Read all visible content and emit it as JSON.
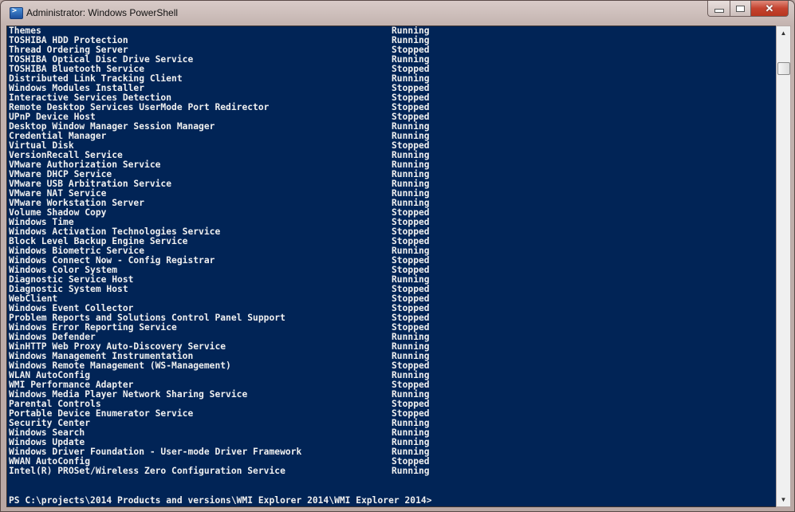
{
  "window": {
    "title": "Administrator: Windows PowerShell",
    "icon": "powershell-icon",
    "controls": {
      "minimize": "minimize-icon",
      "maximize": "maximize-icon",
      "close": "close-icon"
    }
  },
  "console": {
    "background": "#012456",
    "foreground": "#f0f0f0",
    "services": [
      {
        "name": "Themes",
        "status": "Running"
      },
      {
        "name": "TOSHIBA HDD Protection",
        "status": "Running"
      },
      {
        "name": "Thread Ordering Server",
        "status": "Stopped"
      },
      {
        "name": "TOSHIBA Optical Disc Drive Service",
        "status": "Running"
      },
      {
        "name": "TOSHIBA Bluetooth Service",
        "status": "Stopped"
      },
      {
        "name": "Distributed Link Tracking Client",
        "status": "Running"
      },
      {
        "name": "Windows Modules Installer",
        "status": "Stopped"
      },
      {
        "name": "Interactive Services Detection",
        "status": "Stopped"
      },
      {
        "name": "Remote Desktop Services UserMode Port Redirector",
        "status": "Stopped"
      },
      {
        "name": "UPnP Device Host",
        "status": "Stopped"
      },
      {
        "name": "Desktop Window Manager Session Manager",
        "status": "Running"
      },
      {
        "name": "Credential Manager",
        "status": "Running"
      },
      {
        "name": "Virtual Disk",
        "status": "Stopped"
      },
      {
        "name": "VersionRecall Service",
        "status": "Running"
      },
      {
        "name": "VMware Authorization Service",
        "status": "Running"
      },
      {
        "name": "VMware DHCP Service",
        "status": "Running"
      },
      {
        "name": "VMware USB Arbitration Service",
        "status": "Running"
      },
      {
        "name": "VMware NAT Service",
        "status": "Running"
      },
      {
        "name": "VMware Workstation Server",
        "status": "Running"
      },
      {
        "name": "Volume Shadow Copy",
        "status": "Stopped"
      },
      {
        "name": "Windows Time",
        "status": "Stopped"
      },
      {
        "name": "Windows Activation Technologies Service",
        "status": "Stopped"
      },
      {
        "name": "Block Level Backup Engine Service",
        "status": "Stopped"
      },
      {
        "name": "Windows Biometric Service",
        "status": "Running"
      },
      {
        "name": "Windows Connect Now - Config Registrar",
        "status": "Stopped"
      },
      {
        "name": "Windows Color System",
        "status": "Stopped"
      },
      {
        "name": "Diagnostic Service Host",
        "status": "Running"
      },
      {
        "name": "Diagnostic System Host",
        "status": "Stopped"
      },
      {
        "name": "WebClient",
        "status": "Stopped"
      },
      {
        "name": "Windows Event Collector",
        "status": "Stopped"
      },
      {
        "name": "Problem Reports and Solutions Control Panel Support",
        "status": "Stopped"
      },
      {
        "name": "Windows Error Reporting Service",
        "status": "Stopped"
      },
      {
        "name": "Windows Defender",
        "status": "Running"
      },
      {
        "name": "WinHTTP Web Proxy Auto-Discovery Service",
        "status": "Running"
      },
      {
        "name": "Windows Management Instrumentation",
        "status": "Running"
      },
      {
        "name": "Windows Remote Management (WS-Management)",
        "status": "Stopped"
      },
      {
        "name": "WLAN AutoConfig",
        "status": "Running"
      },
      {
        "name": "WMI Performance Adapter",
        "status": "Stopped"
      },
      {
        "name": "Windows Media Player Network Sharing Service",
        "status": "Running"
      },
      {
        "name": "Parental Controls",
        "status": "Stopped"
      },
      {
        "name": "Portable Device Enumerator Service",
        "status": "Stopped"
      },
      {
        "name": "Security Center",
        "status": "Running"
      },
      {
        "name": "Windows Search",
        "status": "Running"
      },
      {
        "name": "Windows Update",
        "status": "Running"
      },
      {
        "name": "Windows Driver Foundation - User-mode Driver Framework",
        "status": "Running"
      },
      {
        "name": "WWAN AutoConfig",
        "status": "Stopped"
      },
      {
        "name": "Intel(R) PROSet/Wireless Zero Configuration Service",
        "status": "Running"
      }
    ],
    "prompt": "PS C:\\projects\\2014 Products and versions\\WMI Explorer 2014\\WMI Explorer 2014>"
  },
  "scrollbar": {
    "up_icon": "scroll-up-arrow-icon",
    "down_icon": "scroll-down-arrow-icon",
    "position_fraction": 0.04
  }
}
